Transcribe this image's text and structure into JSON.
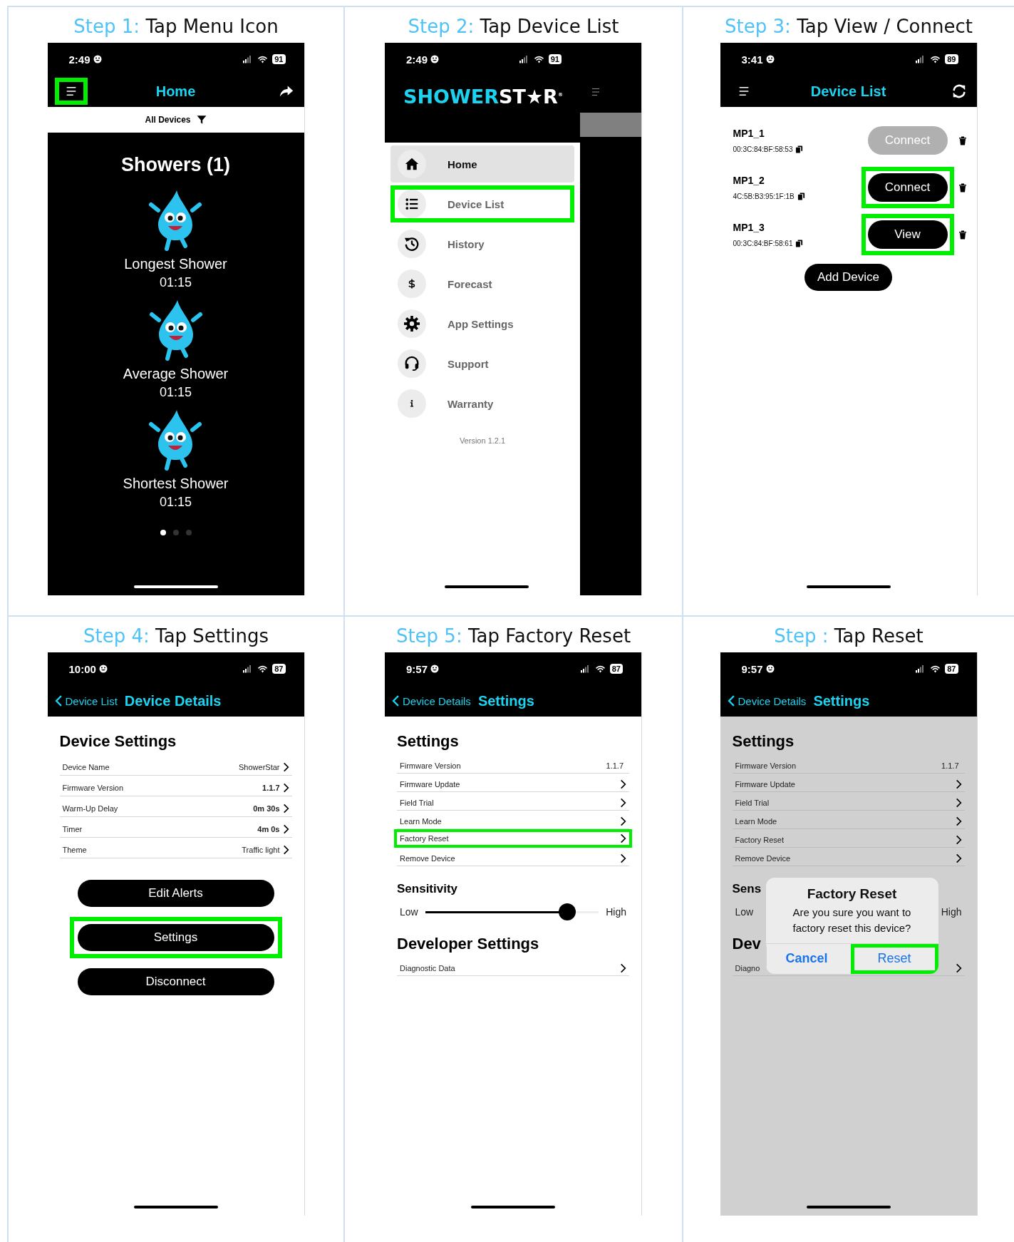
{
  "steps": [
    {
      "step_label": "Step 1:",
      "instruction": "Tap Menu Icon",
      "screen": {
        "kind": "home",
        "status": {
          "time": "2:49",
          "battery": "91"
        },
        "nav": {
          "kind": "menu",
          "title": "Home",
          "menu_highlighted": true
        },
        "filter": "All Devices",
        "heading": "Showers (1)",
        "stats": [
          {
            "label": "Longest Shower",
            "value": "01:15"
          },
          {
            "label": "Average Shower",
            "value": "01:15"
          },
          {
            "label": "Shortest Shower",
            "value": "01:15"
          }
        ],
        "page_dots": [
          {
            "selected": true
          },
          {
            "selected": false
          },
          {
            "selected": false
          }
        ]
      }
    },
    {
      "step_label": "Step 2:",
      "instruction": "Tap Device List",
      "screen": {
        "kind": "drawer",
        "status": {
          "time": "2:49",
          "battery": "91"
        },
        "logo": {
          "part_1": "SHOWER",
          "part_2": "ST★R",
          "mark": "®"
        },
        "items": [
          {
            "label": "Home",
            "selected": true,
            "highlighted": false
          },
          {
            "label": "Device List",
            "selected": false,
            "highlighted": true
          },
          {
            "label": "History",
            "selected": false,
            "highlighted": false
          },
          {
            "label": "Forecast",
            "selected": false,
            "highlighted": false
          },
          {
            "label": "App Settings",
            "selected": false,
            "highlighted": false
          },
          {
            "label": "Support",
            "selected": false,
            "highlighted": false
          },
          {
            "label": "Warranty",
            "selected": false,
            "highlighted": false
          }
        ],
        "version": "Version 1.2.1"
      }
    },
    {
      "step_label": "Step 3:",
      "instruction": "Tap View / Connect",
      "screen": {
        "kind": "device_list",
        "status": {
          "time": "3:41",
          "battery": "89"
        },
        "nav": {
          "kind": "menu",
          "title": "Device List",
          "menu_highlighted": false
        },
        "devices": [
          {
            "name": "MP1_1",
            "address": "00:3C:84:BF:58:53",
            "button": {
              "label": "Connect",
              "disabled": true,
              "highlighted": false
            }
          },
          {
            "name": "MP1_2",
            "address": "4C:5B:B3:95:1F:1B",
            "button": {
              "label": "Connect",
              "disabled": false,
              "highlighted": true
            }
          },
          {
            "name": "MP1_3",
            "address": "00:3C:84:BF:58:61",
            "button": {
              "label": "View",
              "disabled": false,
              "highlighted": true
            }
          }
        ],
        "add_button": "Add Device"
      }
    },
    {
      "step_label": "Step 4:",
      "instruction": "Tap Settings",
      "screen": {
        "kind": "details",
        "status": {
          "time": "10:00",
          "battery": "87"
        },
        "nav": {
          "kind": "back",
          "back_label": "Device List",
          "title": "Device Details"
        },
        "heading": "Device Settings",
        "rows": [
          {
            "label": "Device Name",
            "value": "ShowerStar",
            "emphasized": false,
            "chevron": true
          },
          {
            "label": "Firmware Version",
            "value": "1.1.7",
            "emphasized": true,
            "chevron": true
          },
          {
            "label": "Warm-Up Delay",
            "value": "0m 30s",
            "emphasized": true,
            "chevron": true
          },
          {
            "label": "Timer",
            "value": "4m 0s",
            "emphasized": true,
            "chevron": true
          },
          {
            "label": "Theme",
            "value": "Traffic light",
            "emphasized": false,
            "chevron": true
          }
        ],
        "buttons": [
          {
            "label": "Edit Alerts",
            "highlighted": false
          },
          {
            "label": "Settings",
            "highlighted": true
          },
          {
            "label": "Disconnect",
            "highlighted": false
          }
        ]
      }
    },
    {
      "step_label": "Step 5:",
      "instruction": "Tap Factory Reset",
      "screen": {
        "kind": "settings",
        "status": {
          "time": "9:57",
          "battery": "87"
        },
        "nav": {
          "kind": "back",
          "back_label": "Device Details",
          "title": "Settings"
        },
        "heading": "Settings",
        "rows": [
          {
            "label": "Firmware Version",
            "value": "1.1.7",
            "chevron": false,
            "highlighted": false
          },
          {
            "label": "Firmware Update",
            "chevron": true,
            "highlighted": false
          },
          {
            "label": "Field Trial",
            "chevron": true,
            "highlighted": false
          },
          {
            "label": "Learn Mode",
            "chevron": true,
            "highlighted": false
          },
          {
            "label": "Factory Reset",
            "chevron": true,
            "highlighted": true
          },
          {
            "label": "Remove Device",
            "chevron": true,
            "highlighted": false
          }
        ],
        "sensitivity": {
          "heading": "Sensitivity",
          "low": "Low",
          "high": "High",
          "level": 0.82
        },
        "developer": {
          "heading": "Developer Settings",
          "rows": [
            {
              "label": "Diagnostic Data",
              "chevron": true,
              "highlighted": false
            }
          ]
        }
      }
    },
    {
      "step_label": "Step :",
      "instruction": "Tap Reset",
      "screen": {
        "kind": "settings",
        "status": {
          "time": "9:57",
          "battery": "87"
        },
        "nav": {
          "kind": "back",
          "back_label": "Device Details",
          "title": "Settings"
        },
        "heading": "Settings",
        "rows": [
          {
            "label": "Firmware Version",
            "value": "1.1.7",
            "chevron": false,
            "highlighted": false
          },
          {
            "label": "Firmware Update",
            "chevron": true,
            "highlighted": false
          },
          {
            "label": "Field Trial",
            "chevron": true,
            "highlighted": false
          },
          {
            "label": "Learn Mode",
            "chevron": true,
            "highlighted": false
          },
          {
            "label": "Factory Reset",
            "chevron": true,
            "highlighted": false
          },
          {
            "label": "Remove Device",
            "chevron": true,
            "highlighted": false
          }
        ],
        "sensitivity": {
          "heading": "Sens",
          "low": "Low",
          "high": "High"
        },
        "developer": {
          "heading": "Dev",
          "rows": [
            {
              "label": "Diagno",
              "chevron": true,
              "highlighted": false
            }
          ]
        },
        "dialog": {
          "title": "Factory Reset",
          "message": "Are you sure you want to factory reset this device?",
          "buttons": [
            {
              "label": "Cancel",
              "emphasized": true,
              "highlighted": false
            },
            {
              "label": "Reset",
              "emphasized": false,
              "highlighted": true
            }
          ]
        }
      }
    }
  ]
}
